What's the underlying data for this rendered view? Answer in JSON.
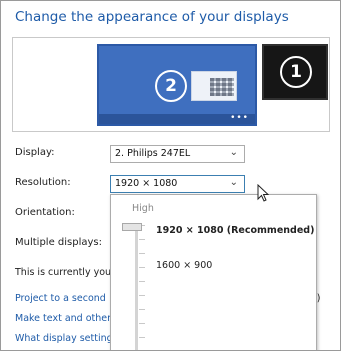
{
  "window": {
    "title": "Change the appearance of your displays"
  },
  "monitors": {
    "secondary": {
      "number": "2",
      "dots": "•••"
    },
    "primary": {
      "number": "1"
    }
  },
  "form": {
    "display": {
      "label": "Display:",
      "value": "2. Philips 247EL"
    },
    "resolution": {
      "label": "Resolution:",
      "value": "1920 × 1080 (Recommended)"
    },
    "orientation": {
      "label": "Orientation:"
    },
    "multiple_displays": {
      "label": "Multiple displays:"
    }
  },
  "info_text": "This is currently you",
  "links": [
    {
      "text": "Project to a second"
    },
    {
      "text": "Make text and other"
    },
    {
      "text": "What display setting"
    }
  ],
  "tail_text": "P)",
  "resolution_dropdown": {
    "high_label": "High",
    "slider_level": 1.0,
    "options": [
      {
        "label": "1920 × 1080 (Recommended)",
        "selected": true
      },
      {
        "label": "1600 × 900",
        "selected": false
      }
    ]
  },
  "colors": {
    "accent": "#1e5ba8",
    "monitor_selected": "#3f6fbf",
    "monitor_other": "#161616"
  }
}
